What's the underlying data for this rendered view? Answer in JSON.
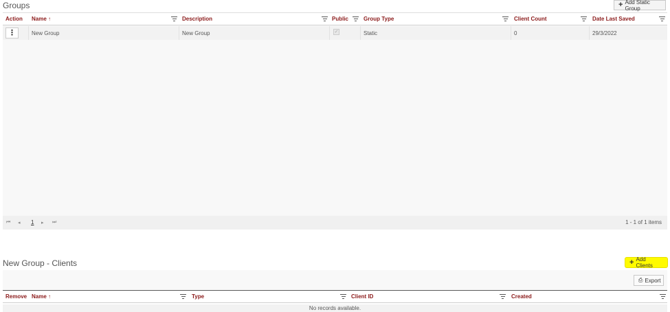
{
  "groups": {
    "title": "Groups",
    "add_button": "Add Static Group",
    "columns": [
      "Action",
      "Name ↑",
      "Description",
      "Public",
      "Group Type",
      "Client Count",
      "Date Last Saved"
    ],
    "rows": [
      {
        "name": "New Group",
        "description": "New Group",
        "public": true,
        "group_type": "Static",
        "client_count": "0",
        "date_last_saved": "29/3/2022"
      }
    ],
    "pager": {
      "page": "1",
      "info": "1 - 1 of 1 items"
    }
  },
  "clients": {
    "title": "New Group - Clients",
    "add_button": "Add Clients",
    "export_button": "Export",
    "columns": [
      "Remove",
      "Name ↑",
      "Type",
      "Client ID",
      "Created"
    ],
    "empty_text": "No records available."
  },
  "colors": {
    "header_text": "#8b1a1a",
    "highlight": "#fffb00"
  }
}
